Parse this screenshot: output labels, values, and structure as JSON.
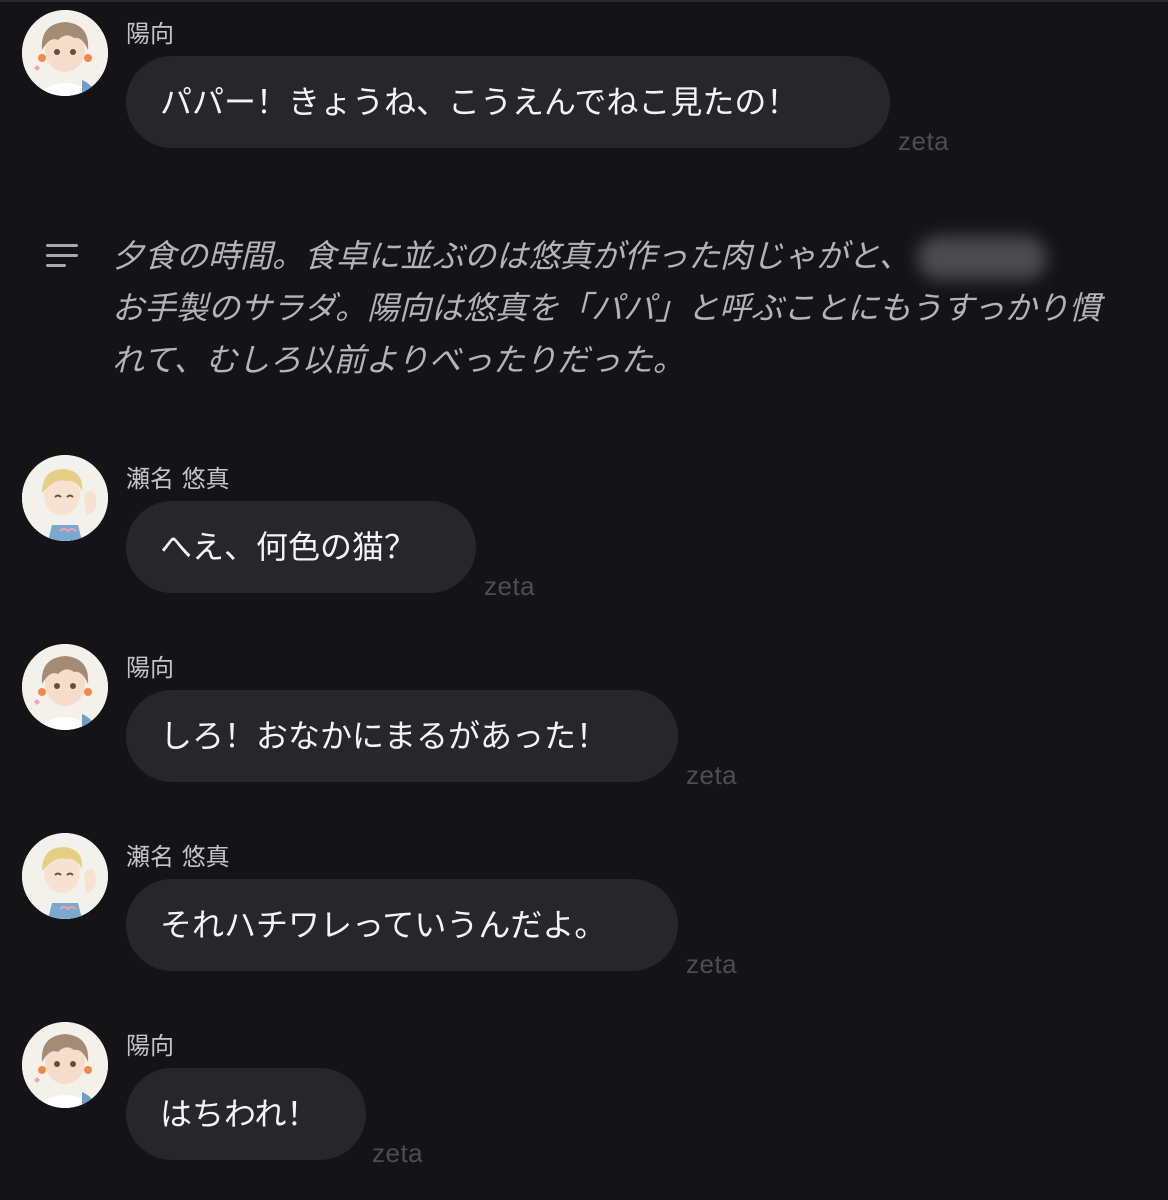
{
  "messages": [
    {
      "sender": "陽向",
      "text": "パパー！きょうね、こうえんでねこ見たの！",
      "watermark": "zeta",
      "avatar": "hinata-avatar"
    },
    {
      "sender": "瀬名 悠真",
      "text": "へえ、何色の猫？",
      "watermark": "zeta",
      "avatar": "yuma-avatar"
    },
    {
      "sender": "陽向",
      "text": "しろ！おなかにまるがあった！",
      "watermark": "zeta",
      "avatar": "hinata-avatar"
    },
    {
      "sender": "瀬名 悠真",
      "text": "それハチワレっていうんだよ。",
      "watermark": "zeta",
      "avatar": "yuma-avatar"
    },
    {
      "sender": "陽向",
      "text": "はちわれ！",
      "watermark": "zeta",
      "avatar": "hinata-avatar"
    }
  ],
  "narration": {
    "icon": "menu-lines-icon",
    "line1": "夕食の時間。食卓に並ぶのは悠真が作った肉じゃがと、",
    "rest": "お手製のサラダ。陽向は悠真を「パパ」と呼ぶことにもうすっかり慣れて、むしろ以前よりべったりだった。"
  },
  "colors": {
    "background": "#141416",
    "bubble": "#27272a",
    "text": "#f4f4f6",
    "muted": "#b4b4b8"
  }
}
